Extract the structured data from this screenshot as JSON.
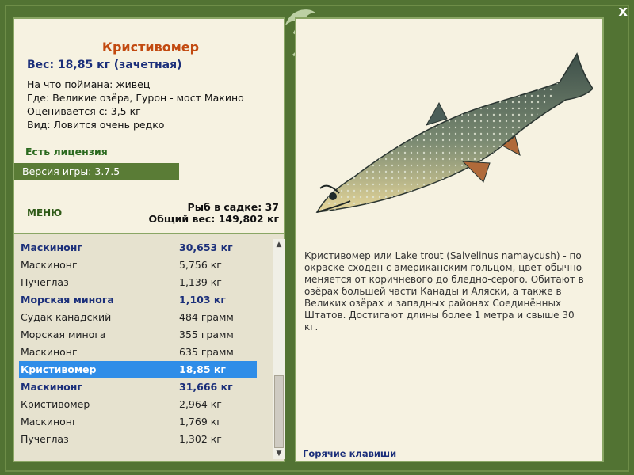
{
  "header": {
    "close_label": "x"
  },
  "catch": {
    "title": "Кристивомер",
    "weight": "Вес: 18,85 кг (зачетная)",
    "caught_with": "На что поймана: живец",
    "location": "Где: Великие озёра, Гурон - мост Макино",
    "rated_from": "Оценивается с: 3,5 кг",
    "rarity": "Вид: Ловится очень редко",
    "license": "Есть лицензия",
    "version": "Версия игры: 3.7.5"
  },
  "menu_label": "меню",
  "stats": {
    "fish_count": "Рыб в садке: 37",
    "total_weight": "Общий вес: 149,802 кг"
  },
  "list": [
    {
      "name": "Маскинонг",
      "weight": "30,653 кг",
      "style": "bold"
    },
    {
      "name": "Маскинонг",
      "weight": "5,756 кг",
      "style": ""
    },
    {
      "name": "Пучеглаз",
      "weight": "1,139 кг",
      "style": ""
    },
    {
      "name": "Морская минога",
      "weight": "1,103 кг",
      "style": "bold"
    },
    {
      "name": "Судак канадский",
      "weight": "484 грамм",
      "style": ""
    },
    {
      "name": "Морская минога",
      "weight": "355 грамм",
      "style": ""
    },
    {
      "name": "Маскинонг",
      "weight": "635 грамм",
      "style": ""
    },
    {
      "name": "Кристивомер",
      "weight": "18,85 кг",
      "style": "sel"
    },
    {
      "name": "Маскинонг",
      "weight": "31,666 кг",
      "style": "bold"
    },
    {
      "name": "Кристивомер",
      "weight": "2,964 кг",
      "style": ""
    },
    {
      "name": "Маскинонг",
      "weight": "1,769 кг",
      "style": ""
    },
    {
      "name": "Пучеглаз",
      "weight": "1,302 кг",
      "style": ""
    }
  ],
  "description": "Кристивомер или Lake trout (Salvelinus namaycush) - по окраске сходен с американским гольцом, цвет обычно меняется от коричневого до бледно-серого. Обитают в озёрах большей части Канады и Аляски, а также в Великих озёрах и западных районах Соединённых Штатов. Достигают длины более 1 метра и свыше 30 кг.",
  "hotkeys_label": "Горячие клавиши",
  "colors": {
    "frame": "#527333",
    "panel": "#f6f2e1",
    "title": "#c24a10",
    "weight": "#1b2f7a",
    "selected": "#2f8de8"
  }
}
